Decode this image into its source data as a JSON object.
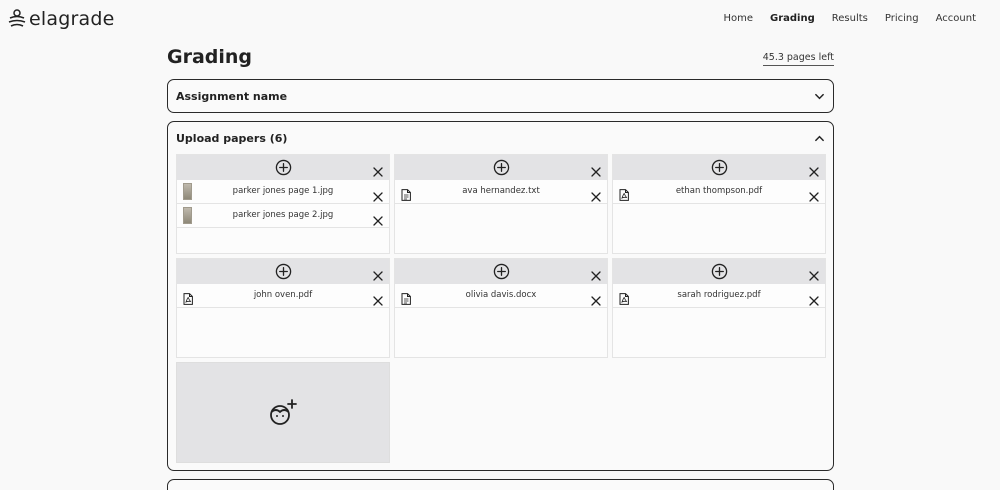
{
  "app": {
    "logo_text": "elagrade",
    "colors": {
      "accent": "#222222",
      "card_header": "#e3e3e5",
      "background": "#f9f9f9"
    }
  },
  "nav": {
    "items": [
      {
        "label": "Home",
        "active": false
      },
      {
        "label": "Grading",
        "active": true
      },
      {
        "label": "Results",
        "active": false
      },
      {
        "label": "Pricing",
        "active": false
      },
      {
        "label": "Account",
        "active": false
      }
    ]
  },
  "page": {
    "title": "Grading",
    "pages_left": "45.3 pages left"
  },
  "assignment": {
    "label": "Assignment name",
    "icon": "chevron-down-icon"
  },
  "upload": {
    "label": "Upload papers (6)",
    "icon": "chevron-up-icon",
    "cards": [
      {
        "files": [
          {
            "name": "parker jones page 1.jpg",
            "type": "image"
          },
          {
            "name": "parker jones page 2.jpg",
            "type": "image"
          }
        ]
      },
      {
        "files": [
          {
            "name": "ava hernandez.txt",
            "type": "text"
          }
        ]
      },
      {
        "files": [
          {
            "name": "ethan thompson.pdf",
            "type": "pdf"
          }
        ]
      },
      {
        "files": [
          {
            "name": "john oven.pdf",
            "type": "pdf"
          }
        ]
      },
      {
        "files": [
          {
            "name": "olivia davis.docx",
            "type": "doc"
          }
        ]
      },
      {
        "files": [
          {
            "name": "sarah rodriguez.pdf",
            "type": "pdf"
          }
        ]
      }
    ],
    "add_student_icon": "add-student-icon"
  }
}
